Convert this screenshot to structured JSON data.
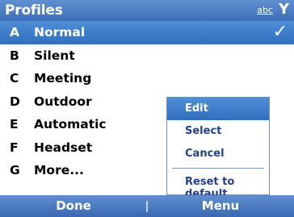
{
  "title_bar": {
    "title": "Profiles",
    "input_mode": "abc",
    "signal_glyph": "Y",
    "signal_icon": "signal-strength-icon"
  },
  "profiles": [
    {
      "key": "A",
      "label": "Normal",
      "selected": true
    },
    {
      "key": "B",
      "label": "Silent",
      "selected": false
    },
    {
      "key": "C",
      "label": "Meeting",
      "selected": false
    },
    {
      "key": "D",
      "label": "Outdoor",
      "selected": false
    },
    {
      "key": "E",
      "label": "Automatic",
      "selected": false
    },
    {
      "key": "F",
      "label": "Headset",
      "selected": false
    },
    {
      "key": "G",
      "label": "More...",
      "selected": false
    }
  ],
  "selected_check_icon": "checkmark-icon",
  "context_menu": {
    "items": [
      {
        "label": "Edit",
        "selected": true
      },
      {
        "label": "Select",
        "selected": false
      },
      {
        "label": "Cancel",
        "selected": false
      },
      {
        "label": "Reset to default",
        "selected": false
      }
    ]
  },
  "softkeys": {
    "left": "Done",
    "right": "Menu"
  }
}
